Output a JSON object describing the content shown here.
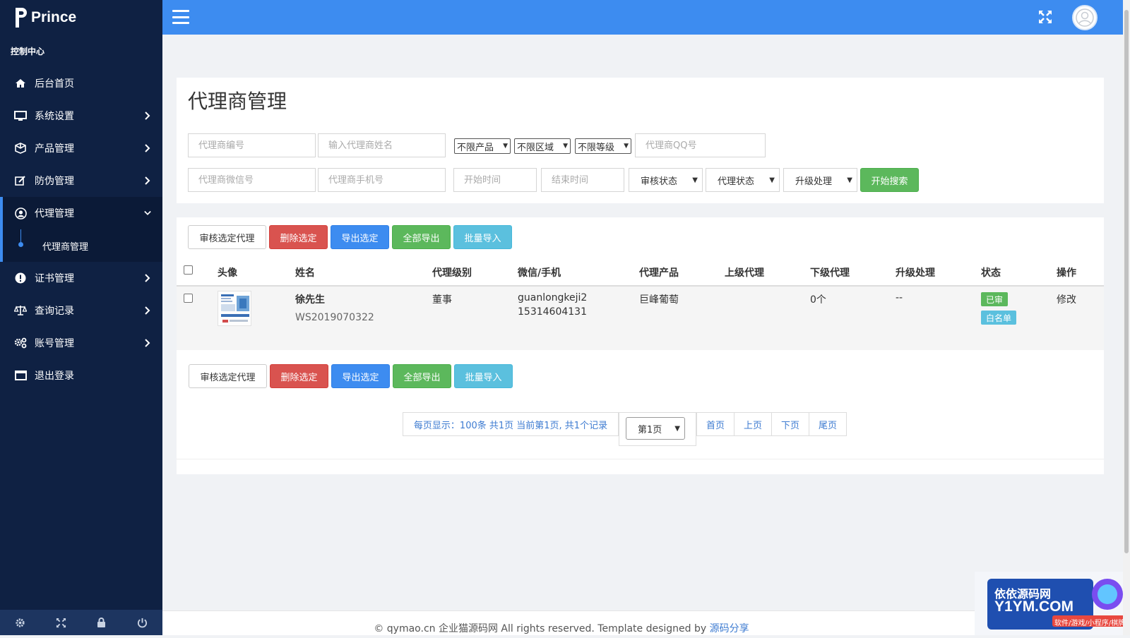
{
  "brand": {
    "name": "Prince"
  },
  "sidebar": {
    "section_title": "控制中心",
    "items": [
      {
        "label": "后台首页",
        "icon": "home-icon",
        "has_children": false
      },
      {
        "label": "系统设置",
        "icon": "monitor-icon",
        "has_children": true
      },
      {
        "label": "产品管理",
        "icon": "cube-icon",
        "has_children": true
      },
      {
        "label": "防伪管理",
        "icon": "edit-icon",
        "has_children": true
      },
      {
        "label": "代理管理",
        "icon": "user-circle-icon",
        "has_children": true,
        "expanded": true
      },
      {
        "label": "证书管理",
        "icon": "exclamation-circle-icon",
        "has_children": true
      },
      {
        "label": "查询记录",
        "icon": "balance-scale-icon",
        "has_children": true
      },
      {
        "label": "账号管理",
        "icon": "cogs-icon",
        "has_children": true
      },
      {
        "label": "退出登录",
        "icon": "window-icon",
        "has_children": false
      }
    ],
    "sub_item": {
      "label": "代理商管理"
    },
    "footer_icons": [
      "gear-icon",
      "expand-icon",
      "lock-icon",
      "power-icon"
    ]
  },
  "topbar": {
    "menu_icon": "hamburger-icon",
    "fullscreen_icon": "expand-icon",
    "avatar_icon": "user-avatar-icon"
  },
  "search": {
    "title": "代理商管理",
    "agent_no_placeholder": "代理商编号",
    "agent_name_placeholder": "输入代理商姓名",
    "product_select": "不限产品",
    "region_select": "不限区域",
    "level_select": "不限等级",
    "qq_placeholder": "代理商QQ号",
    "wechat_placeholder": "代理商微信号",
    "phone_placeholder": "代理商手机号",
    "start_placeholder": "开始时间",
    "end_placeholder": "结束时间",
    "audit_select": "审核状态",
    "agent_status_select": "代理状态",
    "upgrade_select": "升级处理",
    "search_button": "开始搜索"
  },
  "actions": {
    "approve": "审核选定代理",
    "delete": "删除选定",
    "export_selected": "导出选定",
    "export_all": "全部导出",
    "batch_import": "批量导入"
  },
  "table": {
    "headers": [
      "头像",
      "姓名",
      "代理级别",
      "微信/手机",
      "代理产品",
      "上级代理",
      "下级代理",
      "升级处理",
      "状态",
      "操作"
    ],
    "rows": [
      {
        "name": "徐先生",
        "code": "WS2019070322",
        "level": "董事",
        "wechat": "guanlongkeji2",
        "phone": "15314604131",
        "product": "巨峰葡萄",
        "parent": "",
        "children": "0个",
        "upgrade": "--",
        "status_audit": "已审",
        "status_whitelist": "白名单",
        "op": "修改"
      }
    ]
  },
  "pagination": {
    "info": "每页显示：100条 共1页  当前第1页, 共1个记录",
    "page_select": "第1页",
    "first": "首页",
    "prev": "上页",
    "next": "下页",
    "last": "尾页"
  },
  "footer": {
    "text": "© qymao.cn 企业猫源码网 All rights reserved. Template designed by ",
    "link": "源码分享"
  },
  "watermark": {
    "line1": "依依源码网",
    "line2": "Y1YM.COM",
    "line3": "软件/游戏/小程序/棋牌"
  },
  "colors": {
    "sidebar_bg": "#0f2143",
    "topbar_bg": "#3d8cf0",
    "accent": "#3d8cf0",
    "green": "#5cb85c",
    "red": "#d9534f",
    "cyan": "#5bc0de"
  }
}
